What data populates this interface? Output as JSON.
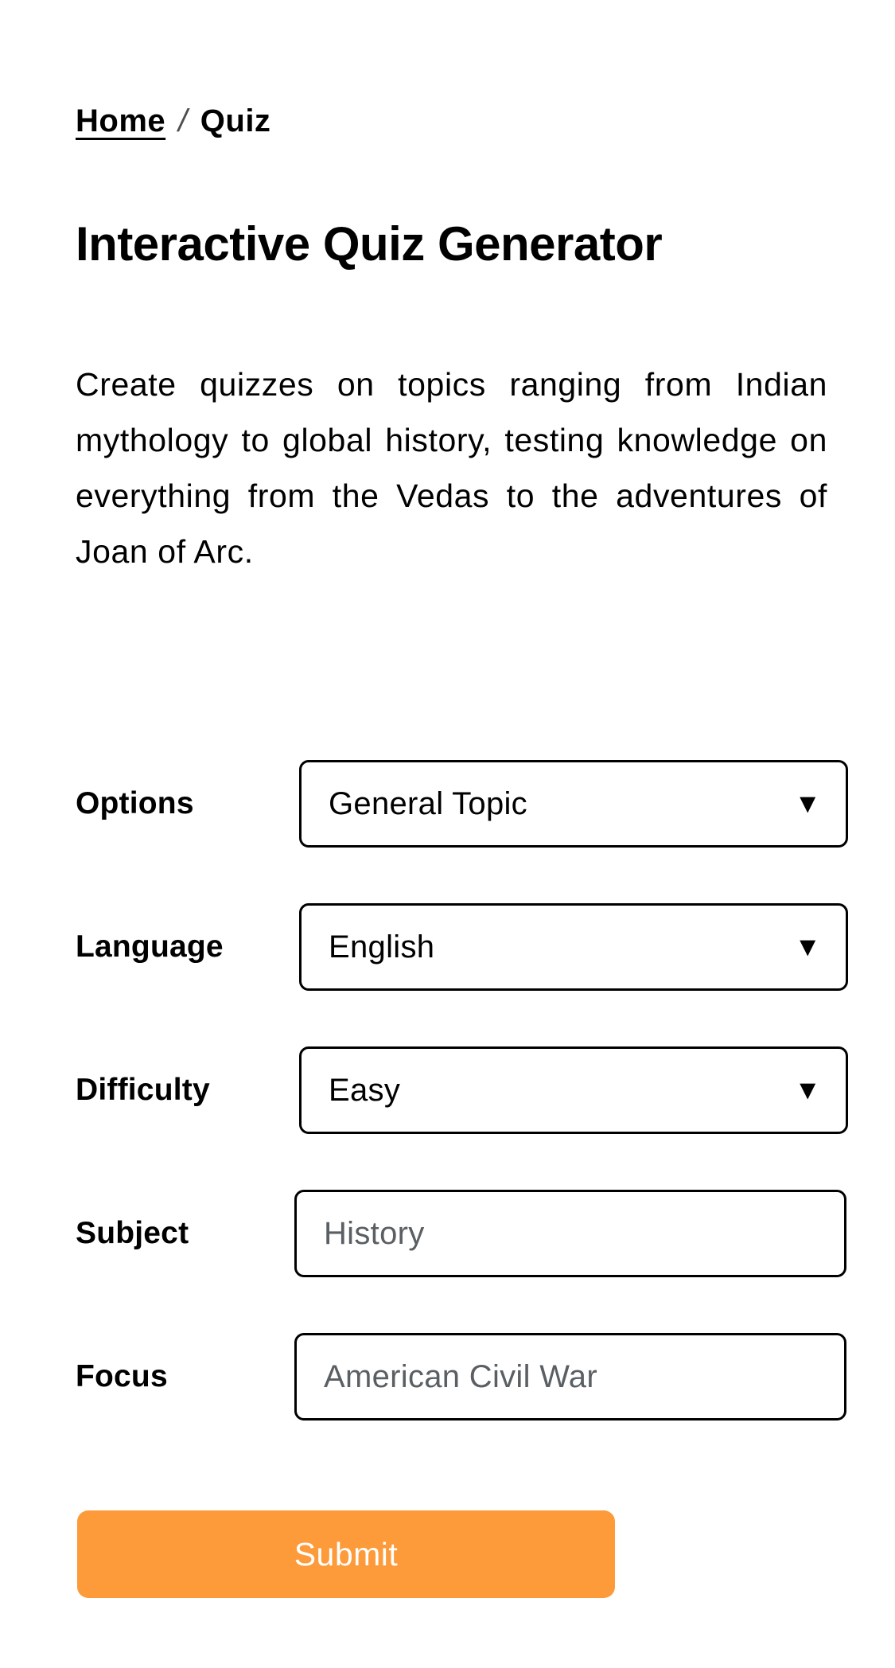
{
  "breadcrumb": {
    "home_label": "Home",
    "separator": "/",
    "current_label": "Quiz"
  },
  "header": {
    "title": "Interactive Quiz Generator",
    "description": "Create quizzes on topics ranging from Indian mythology to global history, testing knowledge on everything from the Vedas to the adventures of Joan of Arc."
  },
  "form": {
    "rows": [
      {
        "label": "Options",
        "type": "select",
        "value": "General Topic",
        "arrow": "▼"
      },
      {
        "label": "Language",
        "type": "select",
        "value": "English",
        "arrow": "▼"
      },
      {
        "label": "Difficulty",
        "type": "select",
        "value": "Easy",
        "arrow": "▼"
      },
      {
        "label": "Subject",
        "type": "text",
        "value": "",
        "placeholder": "History"
      },
      {
        "label": "Focus",
        "type": "text",
        "value": "",
        "placeholder": "American Civil War"
      }
    ],
    "submit_label": "Submit"
  },
  "colors": {
    "accent": "#fd9a39",
    "text": "#000000",
    "placeholder": "#5a5f63",
    "background": "#ffffff"
  }
}
